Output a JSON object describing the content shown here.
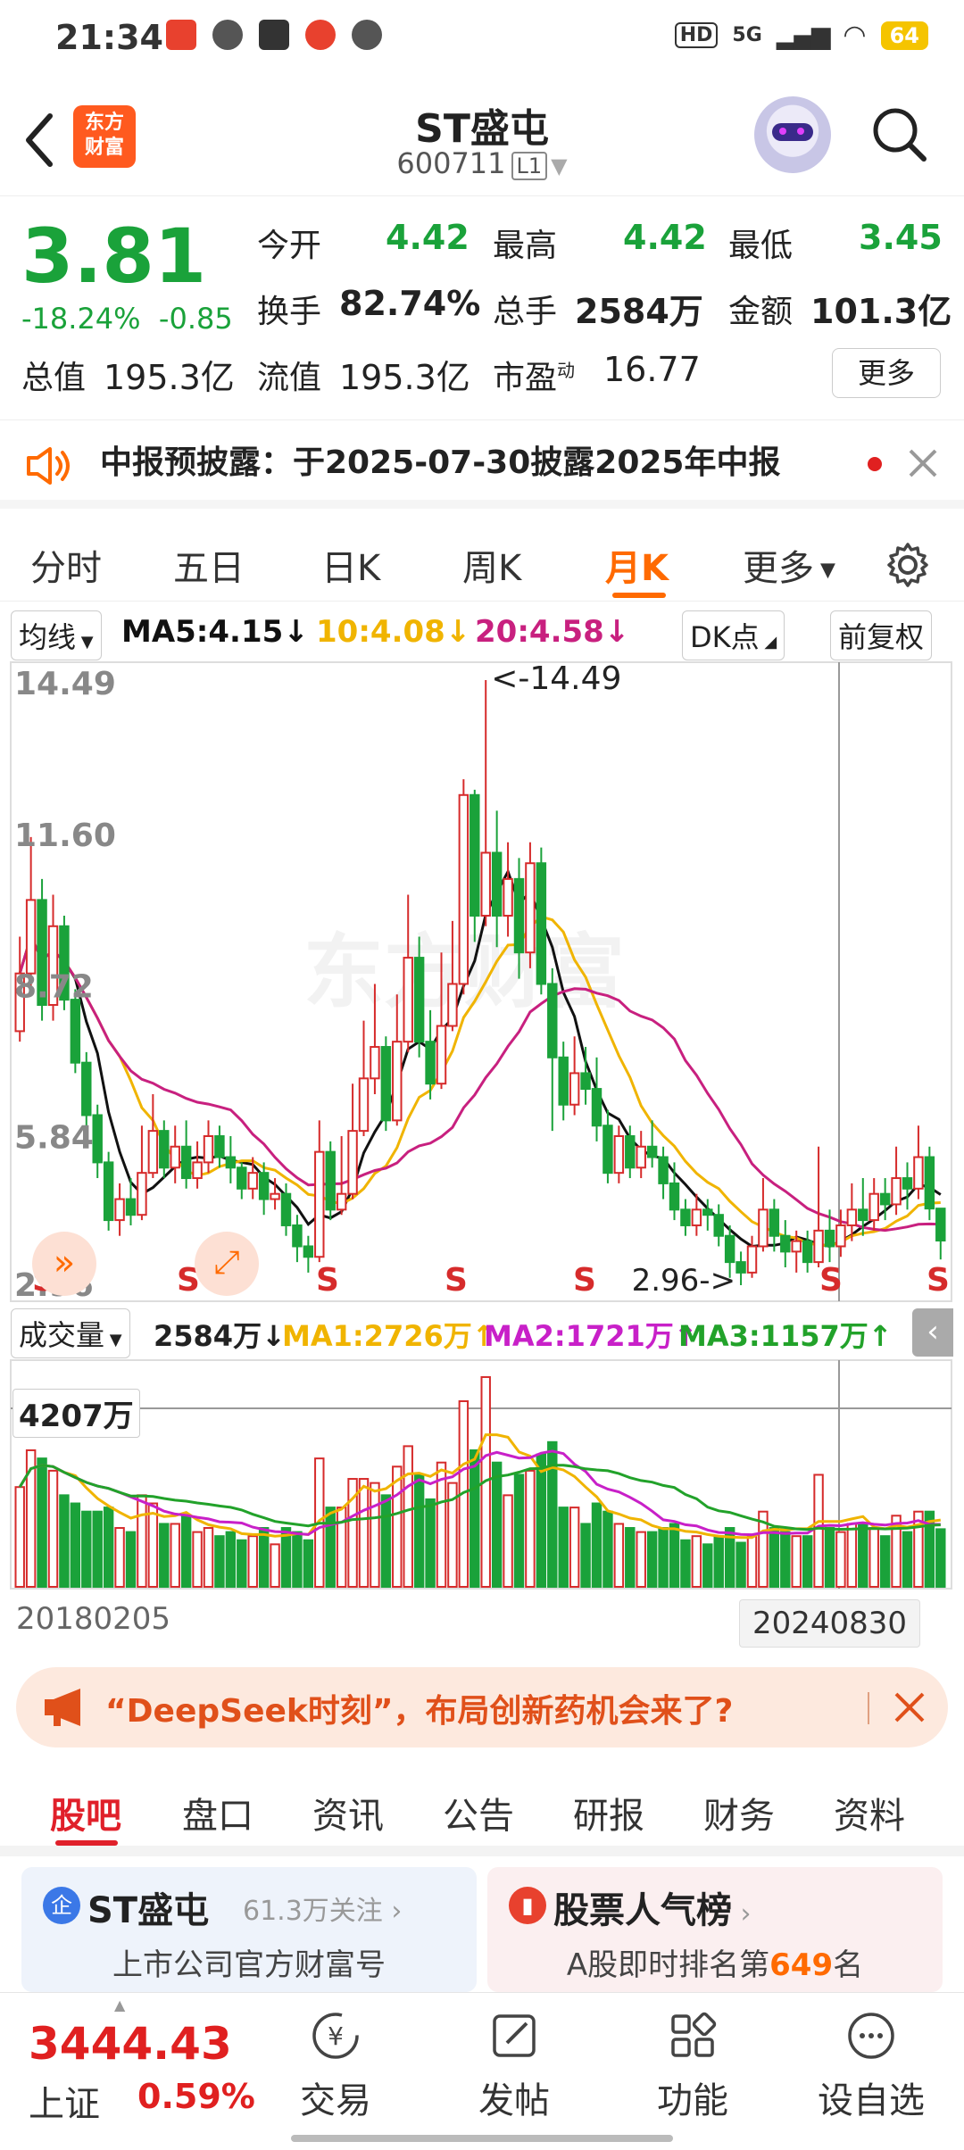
{
  "status": {
    "time": "21:34",
    "battery": "64",
    "signal_label": "5G"
  },
  "header": {
    "back_icon": "back-arrow-icon",
    "logo_text": "东方财富",
    "title": "ST盛屯",
    "code": "600711",
    "level": "L1"
  },
  "quote": {
    "price": "3.81",
    "change_pct": "-18.24%",
    "change": "-0.85",
    "fields": [
      {
        "label": "今开",
        "value": "4.42"
      },
      {
        "label": "最高",
        "value": "4.42"
      },
      {
        "label": "最低",
        "value": "3.45"
      },
      {
        "label": "换手",
        "value": "82.74%"
      },
      {
        "label": "总手",
        "value": "2584万"
      },
      {
        "label": "金额",
        "value": "101.3亿"
      },
      {
        "label": "总值",
        "value": "195.3亿"
      },
      {
        "label": "流值",
        "value": "195.3亿"
      },
      {
        "label": "市盈",
        "sup": "动",
        "value": "16.77"
      }
    ],
    "more": "更多"
  },
  "notice": {
    "text": "中报预披露：于2025-07-30披露2025年中报"
  },
  "tabs": [
    "分时",
    "五日",
    "日K",
    "周K",
    "月K",
    "更多"
  ],
  "active_tab": "月K",
  "ma": {
    "chip": "均线",
    "ma5": "MA5:4.15↓",
    "ma10": "10:4.08↓",
    "ma20": "20:4.58↓",
    "dk": "DK点",
    "adj": "前复权"
  },
  "chart_labels": {
    "y_ticks": [
      "14.49",
      "11.60",
      "8.72",
      "5.84",
      "2.96"
    ],
    "high_marker": "<-14.49",
    "low_marker": "2.96->",
    "s_marks": [
      "S",
      "S",
      "S",
      "S",
      "S",
      "S",
      "S"
    ]
  },
  "volume": {
    "chip": "成交量",
    "current": "2584万↓",
    "ma1": "MA1:2726万↑",
    "ma2": "MA2:1721万↑",
    "ma3": "MA3:1157万↑",
    "level_label": "4207万"
  },
  "dates": {
    "start": "20180205",
    "end": "20240830"
  },
  "banner": {
    "text": "“DeepSeek时刻”，布局创新药机会来了?"
  },
  "subtabs": [
    "股吧",
    "盘口",
    "资讯",
    "公告",
    "研报",
    "财务",
    "资料"
  ],
  "cards": [
    {
      "title": "ST盛屯",
      "follow": "61.3万关注",
      "sub": "上市公司官方财富号"
    },
    {
      "title": "股票人气榜",
      "sub_prefix": "A股即时排名第",
      "rank": "649",
      "sub_suffix": "名"
    }
  ],
  "bottom": {
    "index_value": "3444.43",
    "index_name": "上证",
    "index_pct": "0.59%",
    "nav": [
      "交易",
      "发帖",
      "功能",
      "设自选"
    ]
  },
  "colors": {
    "up": "#d62b2b",
    "down": "#1aa23a",
    "accent": "#ff6a00",
    "ma5": "#111111",
    "ma10": "#f0b400",
    "ma20": "#c8207f",
    "vma2": "#c820c8",
    "vma3": "#22a22a"
  },
  "chart_data": {
    "type": "candlestick",
    "title": "ST盛屯 月K",
    "ylim": [
      2.96,
      14.49
    ],
    "x_range": [
      "20180205",
      "20240830"
    ],
    "candles": [
      [
        7.8,
        8.9,
        7.6,
        9.6
      ],
      [
        8.9,
        10.3,
        8.6,
        11.5
      ],
      [
        10.3,
        8.3,
        8.0,
        10.7
      ],
      [
        8.3,
        9.8,
        8.0,
        10.4
      ],
      [
        9.8,
        8.4,
        8.2,
        10.0
      ],
      [
        8.4,
        7.2,
        7.0,
        8.6
      ],
      [
        7.2,
        6.2,
        6.0,
        7.4
      ],
      [
        6.2,
        5.3,
        5.0,
        6.4
      ],
      [
        5.3,
        4.2,
        4.0,
        5.5
      ],
      [
        4.2,
        4.6,
        3.9,
        4.9
      ],
      [
        4.6,
        4.3,
        4.1,
        5.0
      ],
      [
        4.3,
        5.1,
        4.2,
        6.0
      ],
      [
        5.1,
        5.9,
        5.0,
        6.6
      ],
      [
        5.9,
        5.2,
        5.0,
        6.1
      ],
      [
        5.2,
        5.6,
        4.9,
        6.0
      ],
      [
        5.6,
        5.0,
        4.8,
        6.1
      ],
      [
        5.0,
        5.3,
        4.8,
        5.7
      ],
      [
        5.3,
        5.8,
        5.1,
        6.1
      ],
      [
        5.8,
        5.4,
        5.2,
        6.0
      ],
      [
        5.4,
        5.2,
        4.9,
        5.8
      ],
      [
        5.2,
        4.8,
        4.6,
        5.3
      ],
      [
        4.8,
        5.1,
        4.6,
        5.4
      ],
      [
        5.1,
        4.6,
        4.3,
        5.3
      ],
      [
        4.6,
        4.7,
        4.4,
        5.0
      ],
      [
        4.7,
        4.1,
        3.9,
        4.9
      ],
      [
        4.1,
        3.7,
        3.4,
        4.3
      ],
      [
        3.7,
        3.5,
        3.2,
        3.9
      ],
      [
        3.5,
        5.5,
        3.4,
        6.1
      ],
      [
        5.5,
        4.4,
        4.2,
        5.7
      ],
      [
        4.4,
        4.7,
        4.3,
        5.8
      ],
      [
        4.7,
        5.9,
        4.6,
        6.8
      ],
      [
        5.9,
        6.9,
        5.8,
        8.0
      ],
      [
        6.9,
        7.5,
        6.6,
        8.7
      ],
      [
        7.5,
        6.1,
        5.9,
        7.7
      ],
      [
        6.1,
        7.6,
        6.0,
        8.5
      ],
      [
        7.6,
        9.2,
        7.4,
        10.4
      ],
      [
        9.2,
        7.6,
        7.3,
        9.6
      ],
      [
        7.6,
        6.8,
        6.5,
        8.2
      ],
      [
        6.8,
        7.9,
        6.7,
        9.3
      ],
      [
        7.9,
        8.7,
        7.8,
        9.9
      ],
      [
        8.7,
        12.3,
        8.5,
        12.6
      ],
      [
        12.3,
        10.0,
        9.5,
        12.4
      ],
      [
        10.0,
        11.2,
        9.8,
        14.49
      ],
      [
        11.2,
        10.0,
        9.4,
        12.0
      ],
      [
        10.0,
        10.7,
        9.6,
        11.4
      ],
      [
        10.7,
        9.3,
        8.8,
        11.1
      ],
      [
        9.3,
        11.0,
        9.0,
        11.4
      ],
      [
        11.0,
        8.7,
        8.5,
        11.3
      ],
      [
        8.7,
        7.3,
        5.9,
        9.0
      ],
      [
        7.3,
        6.4,
        6.1,
        7.6
      ],
      [
        6.4,
        7.0,
        6.2,
        7.7
      ],
      [
        7.0,
        6.7,
        6.4,
        7.5
      ],
      [
        6.7,
        6.0,
        5.7,
        7.3
      ],
      [
        6.0,
        5.1,
        4.9,
        6.3
      ],
      [
        5.1,
        5.8,
        4.9,
        6.0
      ],
      [
        5.8,
        5.2,
        5.0,
        6.0
      ],
      [
        5.2,
        5.6,
        5.0,
        5.9
      ],
      [
        5.6,
        5.4,
        5.2,
        6.1
      ],
      [
        5.4,
        4.9,
        4.6,
        5.6
      ],
      [
        4.9,
        4.4,
        4.2,
        5.3
      ],
      [
        4.4,
        4.1,
        3.9,
        4.6
      ],
      [
        4.1,
        4.4,
        3.9,
        4.7
      ],
      [
        4.4,
        4.3,
        4.0,
        4.6
      ],
      [
        4.3,
        3.9,
        3.7,
        4.5
      ],
      [
        3.9,
        3.4,
        3.1,
        4.1
      ],
      [
        3.4,
        3.2,
        2.96,
        3.6
      ],
      [
        3.2,
        3.7,
        3.1,
        3.9
      ],
      [
        3.7,
        4.4,
        3.6,
        5.0
      ],
      [
        4.4,
        3.9,
        3.6,
        4.6
      ],
      [
        3.9,
        3.6,
        3.3,
        4.2
      ],
      [
        3.6,
        3.8,
        3.2,
        4.0
      ],
      [
        3.8,
        3.4,
        3.2,
        4.0
      ],
      [
        3.4,
        4.0,
        3.3,
        5.6
      ],
      [
        4.0,
        3.7,
        3.4,
        4.4
      ],
      [
        3.7,
        4.1,
        3.5,
        4.4
      ],
      [
        4.1,
        4.4,
        3.8,
        4.9
      ],
      [
        4.4,
        4.2,
        3.9,
        5.0
      ],
      [
        4.2,
        4.7,
        4.0,
        5.0
      ],
      [
        4.7,
        4.5,
        4.2,
        5.0
      ],
      [
        4.5,
        5.0,
        4.3,
        5.6
      ],
      [
        5.0,
        4.8,
        4.4,
        5.3
      ],
      [
        4.8,
        5.4,
        4.6,
        6.0
      ],
      [
        5.4,
        4.42,
        4.2,
        5.6
      ],
      [
        4.42,
        3.81,
        3.45,
        4.42
      ]
    ]
  }
}
